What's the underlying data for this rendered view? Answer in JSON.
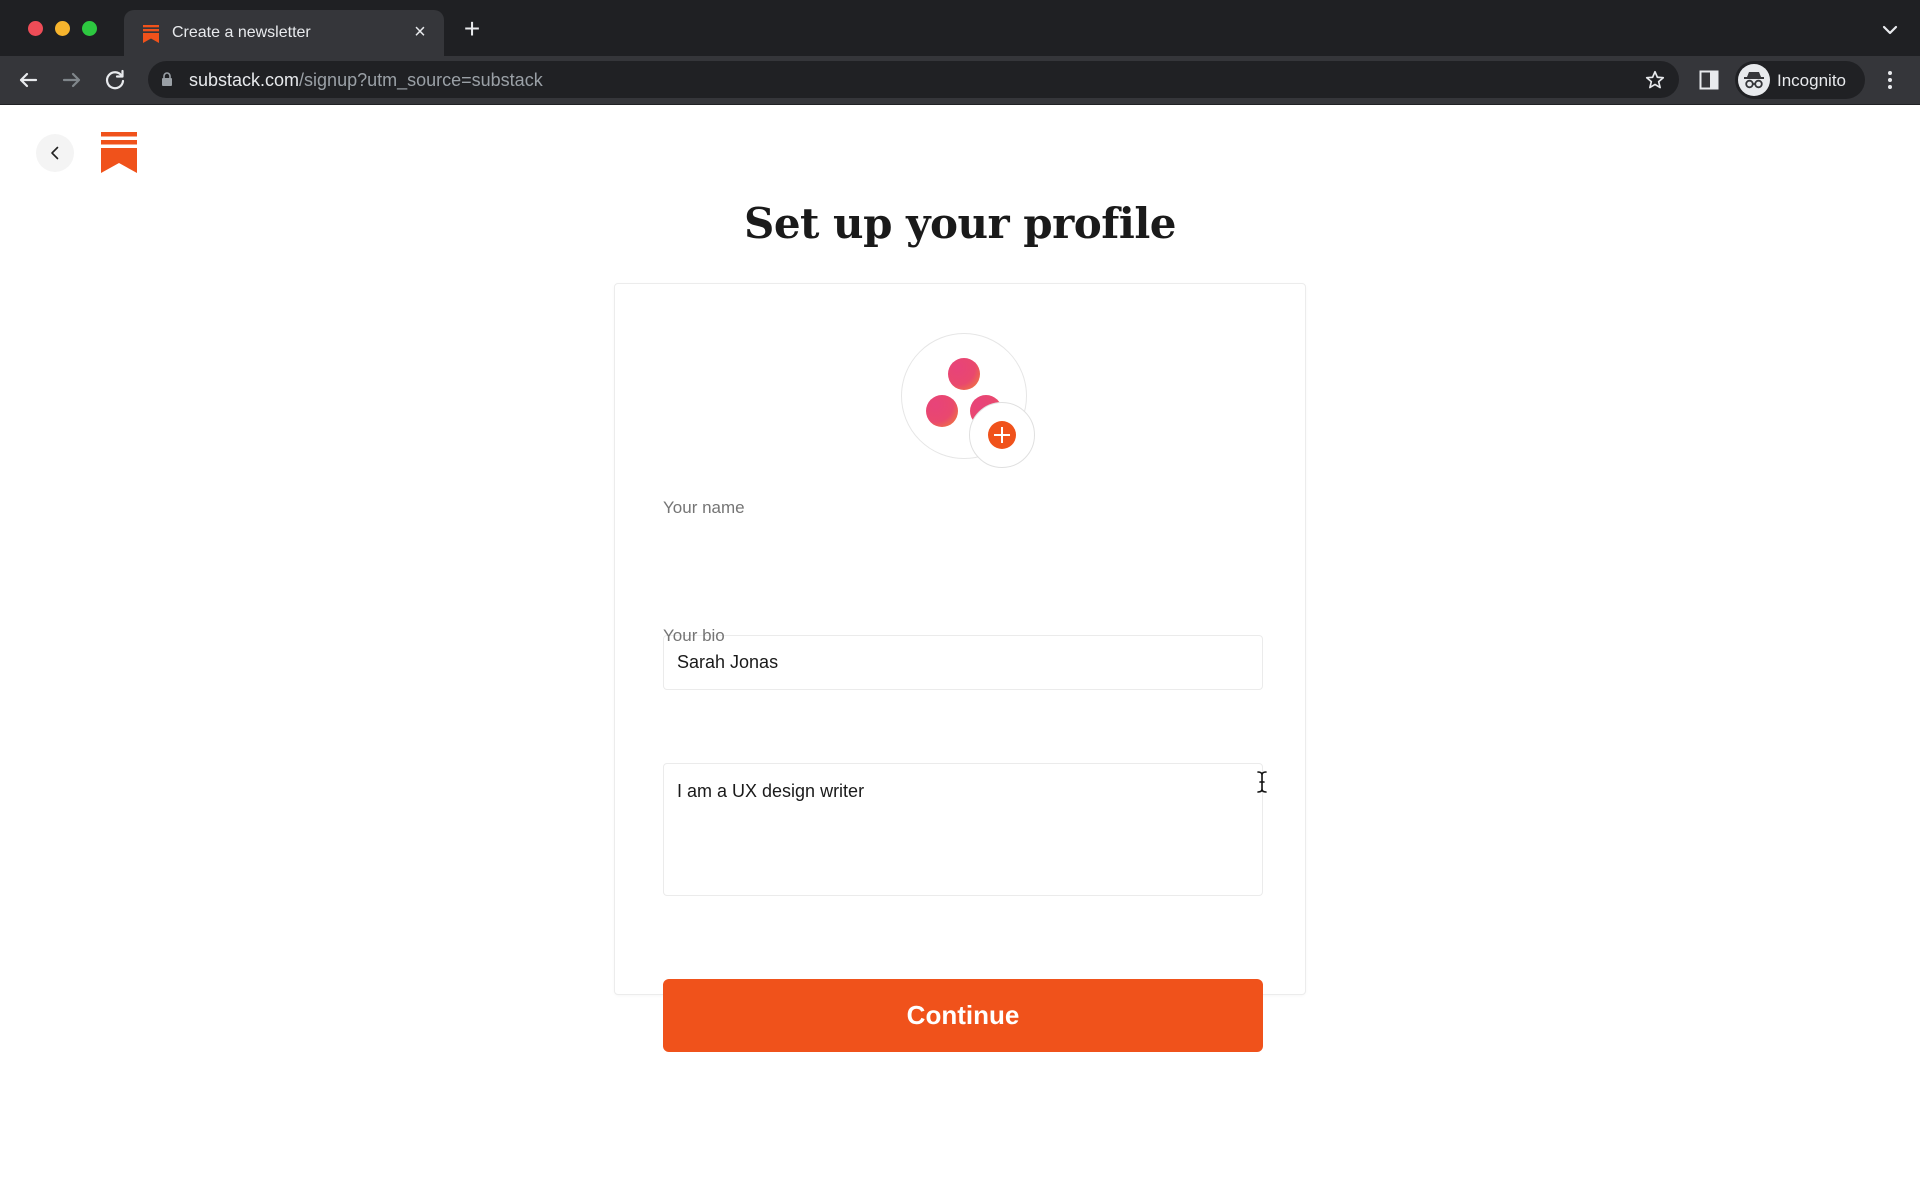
{
  "browser": {
    "tab": {
      "title": "Create a newsletter",
      "favicon": "substack-logo-icon",
      "close_glyph": "×"
    },
    "new_tab_glyph": "+",
    "address_bar": {
      "host": "substack.com",
      "path": "/signup?utm_source=substack"
    },
    "profile_label": "Incognito",
    "icons": [
      "back-arrow-icon",
      "forward-arrow-icon",
      "reload-icon",
      "lock-icon",
      "star-icon",
      "side-panel-icon",
      "incognito-icon",
      "kebab-menu-icon",
      "chevron-down-icon"
    ]
  },
  "page": {
    "title": "Set up your profile",
    "brand_color": "#f0521b",
    "avatar": {
      "icon": "default-avatar-dots-icon",
      "add_icon": "plus-icon"
    },
    "form": {
      "name": {
        "label": "Your name",
        "value": "Sarah Jonas"
      },
      "bio": {
        "label": "Your bio",
        "value": "I am a UX design writer"
      },
      "submit_label": "Continue"
    }
  }
}
